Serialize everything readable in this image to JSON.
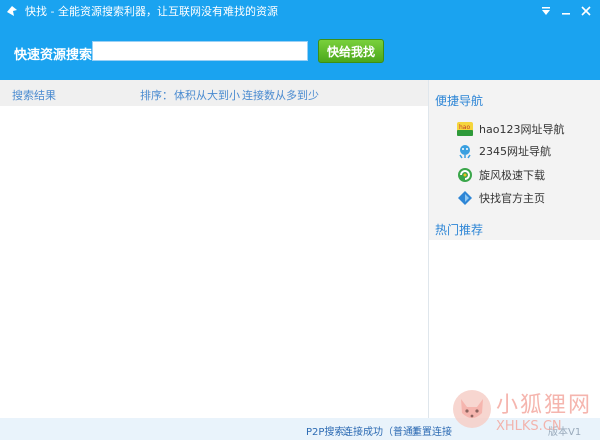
{
  "app": {
    "title": "快找 - 全能资源搜索利器，让互联网没有难找的资源"
  },
  "search": {
    "label": "快速资源搜索",
    "value": "",
    "placeholder": "",
    "button_label": "快给我找"
  },
  "results": {
    "header_label": "搜索结果",
    "sort_label": "排序：",
    "sort_options": [
      "体积从大到小",
      "连接数从多到少"
    ]
  },
  "sidebar": {
    "quick_nav_title": "便捷导航",
    "items": [
      {
        "label": "hao123网址导航",
        "icon": "hao123-icon"
      },
      {
        "label": "2345网址导航",
        "icon": "2345-icon"
      },
      {
        "label": "旋风极速下载",
        "icon": "whirlwind-icon"
      },
      {
        "label": "快找官方主页",
        "icon": "kuaizhao-home-icon"
      }
    ],
    "hot_title": "热门推荐"
  },
  "status": {
    "p2p_label": "P2P搜索：",
    "connection_status": "连接成功（普通）",
    "reconnect_label": "重置连接",
    "version_partial": "版本V1"
  },
  "watermark": {
    "cn": "小狐狸网",
    "en": "XHLKS.CN"
  },
  "colors": {
    "titlebar": "#1aa3f0",
    "button_green": "#4ca81c",
    "link_blue": "#2e86d6"
  }
}
